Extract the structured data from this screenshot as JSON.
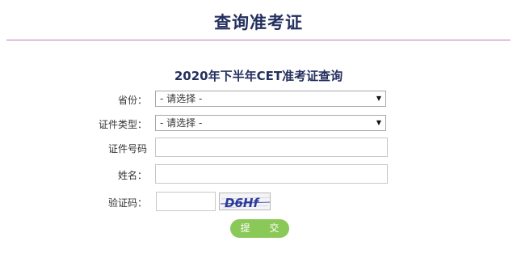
{
  "page": {
    "title": "查询准考证"
  },
  "form": {
    "heading": "2020年下半年CET准考证查询",
    "province": {
      "label": "省份：",
      "selected": "- 请选择 -"
    },
    "id_type": {
      "label": "证件类型：",
      "selected": "- 请选择 -"
    },
    "id_number": {
      "label": "证件号码",
      "value": ""
    },
    "name": {
      "label": "姓名：",
      "value": ""
    },
    "captcha": {
      "label": "验证码：",
      "value": "",
      "image_text": "D6Hf"
    },
    "submit_label": "提 交"
  },
  "colors": {
    "title": "#24305e",
    "rule": "#c77bb1",
    "submit": "#8ac858",
    "captcha_text": "#2a3a9a"
  }
}
